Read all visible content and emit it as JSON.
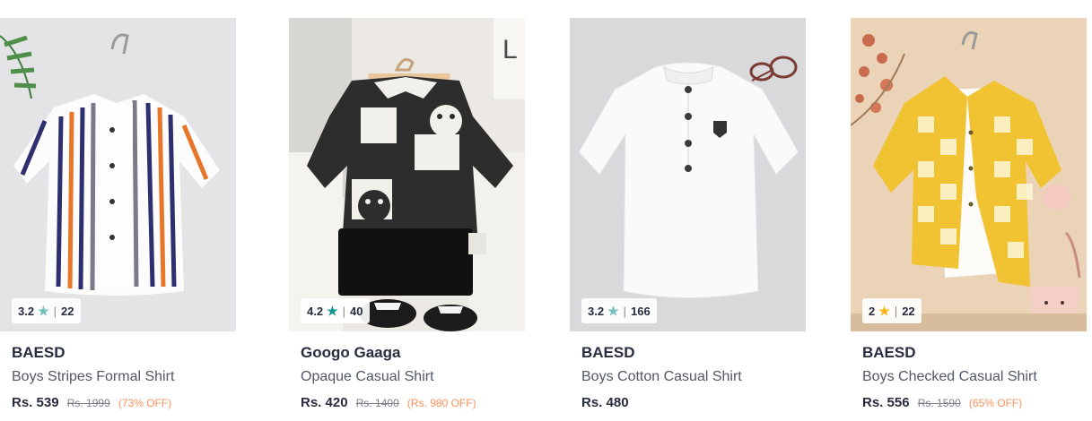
{
  "products": [
    {
      "brand": "Googo Gaaga",
      "name": "Opaque Casual Shirt",
      "price": "Rs. 420",
      "mrp": "Rs. 1400",
      "discount": "(Rs. 980 OFF)",
      "rating": "4.2",
      "rating_count": "40",
      "star_color": "#14958f"
    },
    {
      "brand": "BAESD",
      "name": "Boys Cotton Casual Shirt",
      "price": "Rs. 480",
      "mrp": "",
      "discount": "",
      "rating": "3.2",
      "rating_count": "166",
      "star_color": "#72bfbc"
    },
    {
      "brand": "BAESD",
      "name": "Boys Checked Casual Shirt",
      "price": "Rs. 556",
      "mrp": "Rs. 1590",
      "discount": "(65% OFF)",
      "rating": "2",
      "rating_count": "22",
      "star_color": "#f5b814"
    },
    {
      "brand": "BAESD",
      "name": "Boys Stripes Formal Shirt",
      "price": "Rs. 539",
      "mrp": "Rs. 1999",
      "discount": "(73% OFF)",
      "rating": "3.2",
      "rating_count": "22",
      "star_color": "#72bfbc"
    }
  ],
  "icons": {
    "rating_star": "star-icon"
  },
  "colors": {
    "discount": "#ff905a",
    "text": "#282c3f",
    "muted": "#535766"
  }
}
